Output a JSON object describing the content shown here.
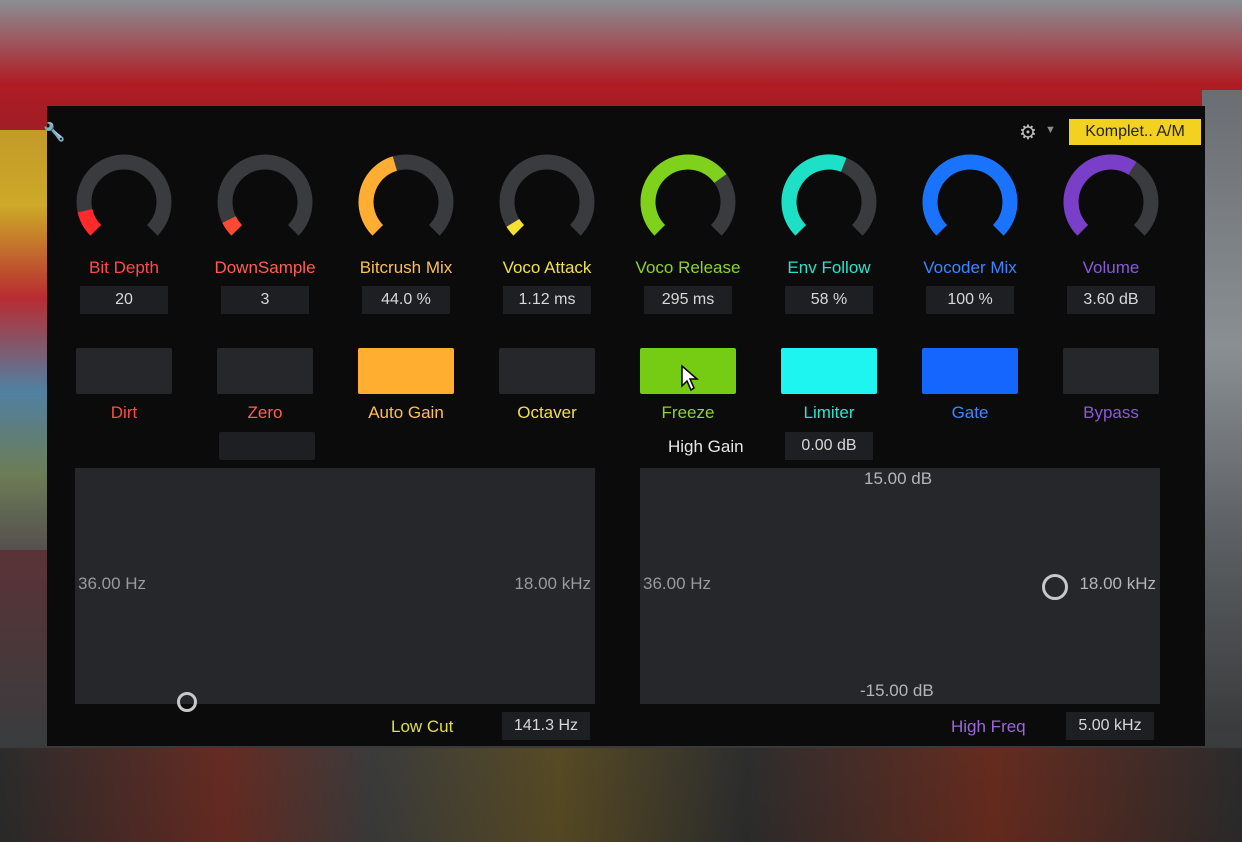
{
  "header": {
    "preset_label": "Komplet.. A/M",
    "settings_icon": "gear-icon",
    "menu_icon": "chevron-down-icon",
    "tool_icon": "wrench-icon"
  },
  "knobs": [
    {
      "label": "Bit Depth",
      "value": "20",
      "color": "#ff2a2a",
      "level": 0.12,
      "label_color": "#ff4a4a"
    },
    {
      "label": "DownSample",
      "value": "3",
      "color": "#ff4a33",
      "level": 0.07,
      "label_color": "#ff5f52"
    },
    {
      "label": "Bitcrush Mix",
      "value": "44.0 %",
      "color": "#ffad33",
      "level": 0.44,
      "label_color": "#ffbf55"
    },
    {
      "label": "Voco Attack",
      "value": "1.12 ms",
      "color": "#f2e033",
      "level": 0.05,
      "label_color": "#f0e04a"
    },
    {
      "label": "Voco Release",
      "value": "295 ms",
      "color": "#7fd11b",
      "level": 0.7,
      "label_color": "#8ed330"
    },
    {
      "label": "Env Follow",
      "value": "58 %",
      "color": "#1ee0c6",
      "level": 0.58,
      "label_color": "#2ae3cf"
    },
    {
      "label": "Vocoder Mix",
      "value": "100 %",
      "color": "#1a73ff",
      "level": 1.0,
      "label_color": "#3e86ff"
    },
    {
      "label": "Volume",
      "value": "3.60 dB",
      "color": "#7a3fc8",
      "level": 0.62,
      "label_color": "#8a5ad6"
    }
  ],
  "toggles": [
    {
      "label": "Dirt",
      "on": false,
      "color": "#26272b",
      "label_color": "#ff4a4a"
    },
    {
      "label": "Zero",
      "on": false,
      "color": "#26272b",
      "label_color": "#ff5f52"
    },
    {
      "label": "Auto Gain",
      "on": true,
      "color": "#ffae30",
      "label_color": "#ffbf55"
    },
    {
      "label": "Octaver",
      "on": false,
      "color": "#26272b",
      "label_color": "#f0e04a"
    },
    {
      "label": "Freeze",
      "on": true,
      "color": "#76cc12",
      "label_color": "#8ed330"
    },
    {
      "label": "Limiter",
      "on": true,
      "color": "#1ef5f0",
      "label_color": "#2ae3cf"
    },
    {
      "label": "Gate",
      "on": true,
      "color": "#1466ff",
      "label_color": "#3e86ff"
    },
    {
      "label": "Bypass",
      "on": false,
      "color": "#26272b",
      "label_color": "#8a5ad6"
    }
  ],
  "high_gain": {
    "label": "High Gain",
    "value": "0.00 dB"
  },
  "left_pad": {
    "left_label": "36.00 Hz",
    "right_label": "18.00 kHz",
    "footer_label": "Low Cut",
    "footer_value": "141.3 Hz"
  },
  "right_pad": {
    "left_label": "36.00 Hz",
    "right_label": "18.00 kHz",
    "top_label": "15.00 dB",
    "bottom_label": "-15.00 dB",
    "footer_label": "High Freq",
    "footer_value": "5.00 kHz"
  }
}
